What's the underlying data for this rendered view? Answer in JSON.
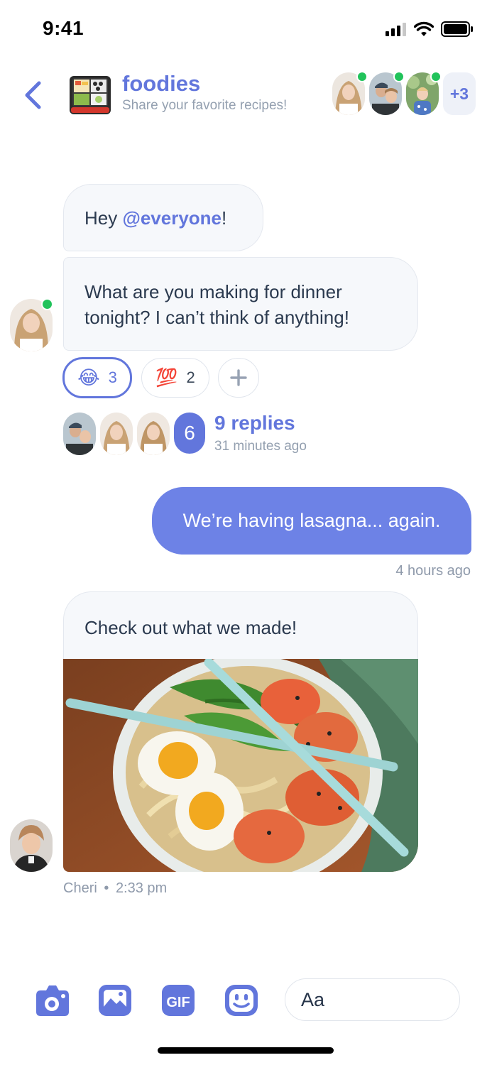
{
  "status_bar": {
    "time": "9:41"
  },
  "header": {
    "group_name": "foodies",
    "subtitle": "Share your favorite recipes!",
    "extra_members": "+3"
  },
  "messages": {
    "first_greeting": "Hey ",
    "first_mention": "@everyone",
    "first_tail": "!",
    "second_line1": "What are you making for dinner",
    "second_line2": "tonight? I can’t think of anything!",
    "reactions": [
      {
        "emoji": "😂",
        "count": "3"
      },
      {
        "emoji": "💯",
        "count": "2"
      }
    ],
    "thread": {
      "avatar_count": "6",
      "replies_label": "9 replies",
      "time": "31 minutes ago"
    },
    "outgoing_text": "We’re having lasagna... again.",
    "outgoing_time": "4 hours ago",
    "photo_caption": "Check out what we made!",
    "photo_author": "Cheri",
    "photo_dot": "•",
    "photo_time": "2:33 pm"
  },
  "composer": {
    "placeholder": "Aa"
  },
  "colors": {
    "accent": "#6276dc",
    "outgoing": "#6d82e6",
    "online": "#21c35b"
  }
}
